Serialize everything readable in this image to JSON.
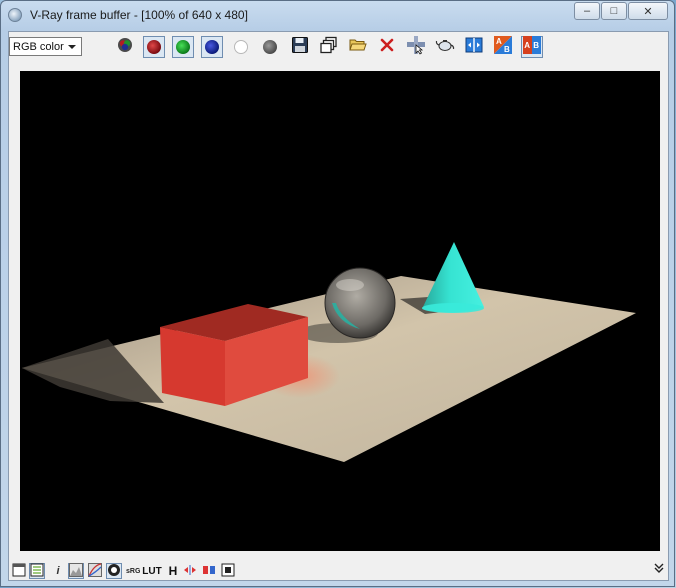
{
  "window": {
    "title": "V-Ray frame buffer - [100% of 640 x 480]",
    "controls": {
      "minimize": "–",
      "maximize": "□",
      "close": "✕"
    }
  },
  "toolbar": {
    "channel": "RGB color",
    "colors": {
      "red": "#c0161e",
      "green": "#1a9a2a",
      "blue": "#1a2a9a",
      "clear": "#cc1e1e",
      "accent": "#2a7bd8"
    }
  },
  "statusbar": {
    "info_label": "i",
    "lut_label": "LUT",
    "histogram_label": "H"
  },
  "render": {
    "background": "#000000",
    "plane_color": "#d9cbb1",
    "box_color": "#d23a2f",
    "cone_color": "#2fd8c8",
    "sphere_color": "#8a8a8a"
  }
}
